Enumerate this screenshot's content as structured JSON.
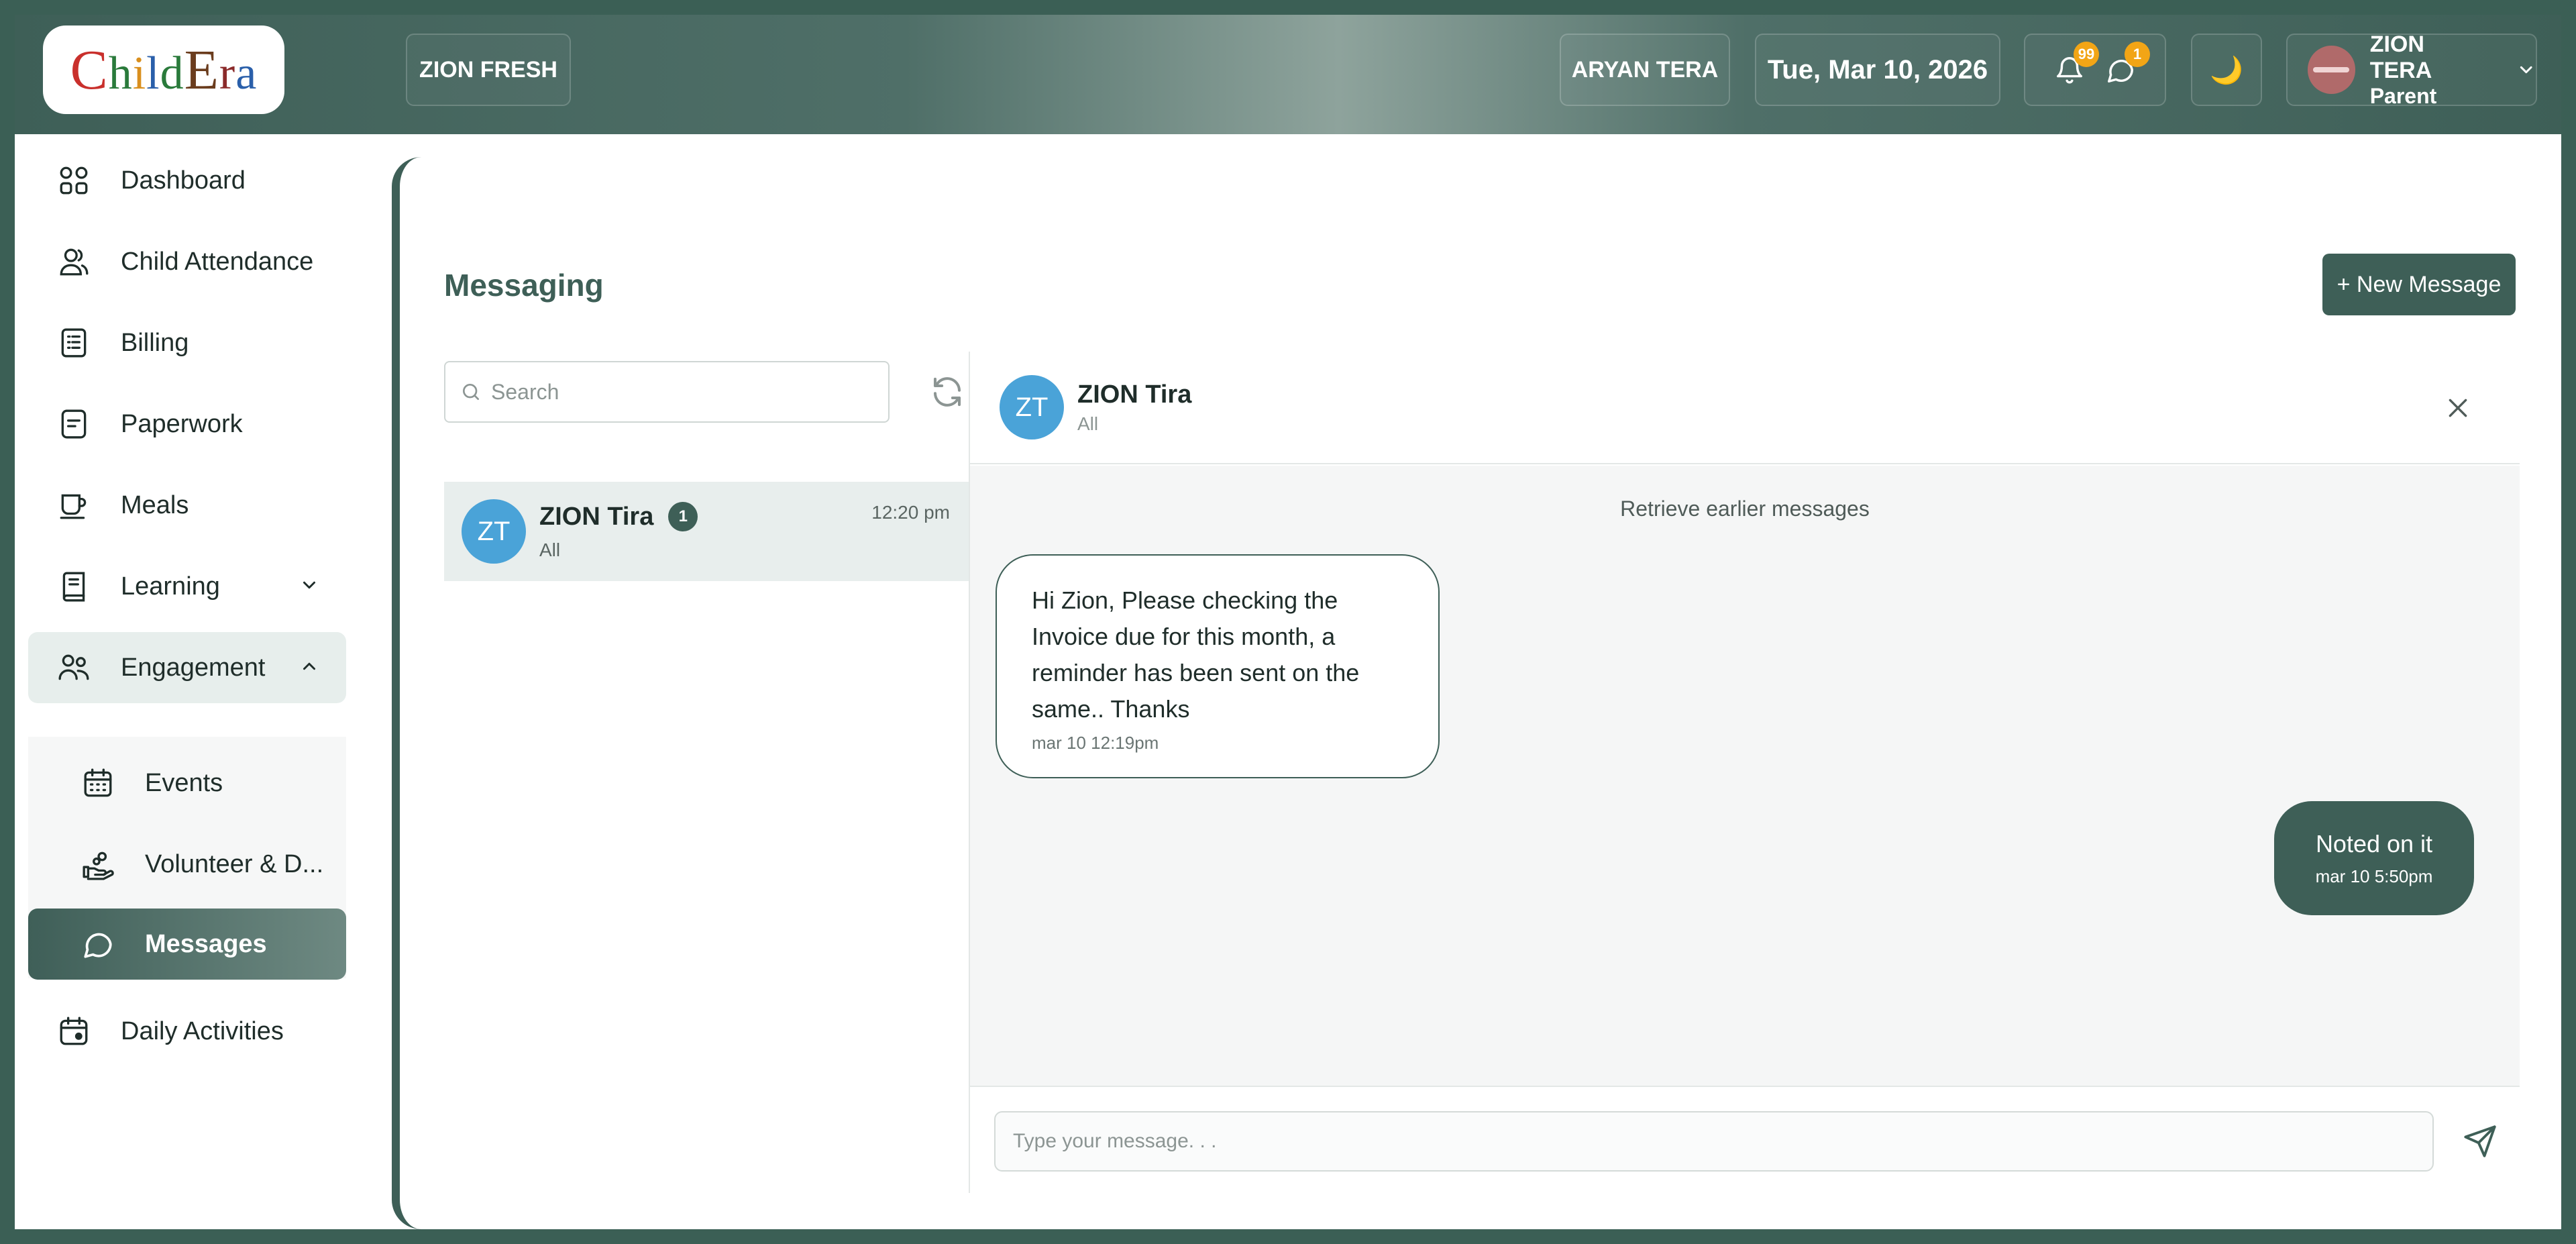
{
  "header": {
    "logo": {
      "text": "ChildEra"
    },
    "school_name": "ZION FRESH",
    "user_name": "ARYAN TERA",
    "date": "Tue, Mar 10, 2026",
    "notifications": {
      "bell_count": "99",
      "chat_count": "1"
    },
    "theme_icon": "🌙",
    "profile": {
      "name": "ZION TERA",
      "role": "Parent"
    }
  },
  "sidebar": {
    "items": [
      {
        "label": "Dashboard",
        "icon": "grid-icon"
      },
      {
        "label": "Child Attendance",
        "icon": "users-icon"
      },
      {
        "label": "Billing",
        "icon": "receipt-icon"
      },
      {
        "label": "Paperwork",
        "icon": "document-icon"
      },
      {
        "label": "Meals",
        "icon": "cup-icon"
      },
      {
        "label": "Learning",
        "icon": "book-icon"
      },
      {
        "label": "Engagement",
        "icon": "people-icon"
      },
      {
        "label": "Events",
        "icon": "calendar-icon"
      },
      {
        "label": "Volunteer & D...",
        "icon": "hand-icon"
      },
      {
        "label": "Messages",
        "icon": "chat-bubble-icon"
      },
      {
        "label": "Daily Activities",
        "icon": "calendar-clock-icon"
      }
    ]
  },
  "main": {
    "title": "Messaging",
    "new_message_label": "+ New Message",
    "search": {
      "placeholder": "Search",
      "value": ""
    },
    "conversations": [
      {
        "initials": "ZT",
        "name": "ZION Tira",
        "unread": "1",
        "group": "All",
        "time": "12:20 pm"
      }
    ],
    "chat": {
      "initials": "ZT",
      "name": "ZION Tira",
      "group": "All",
      "retrieve_label": "Retrieve earlier messages",
      "messages": [
        {
          "direction": "in",
          "text": "Hi Zion, Please checking the Invoice due for this month, a reminder has been sent on the same.. Thanks",
          "time": "mar 10 12:19pm"
        },
        {
          "direction": "out",
          "text": "Noted on it",
          "time": "mar 10 5:50pm"
        }
      ],
      "composer": {
        "placeholder": "Type your message. . .",
        "value": ""
      }
    }
  },
  "colors": {
    "primary": "#3e5f57",
    "avatar_blue": "#4aa3d8",
    "badge_orange": "#f2a516",
    "chat_bg": "#f5f6f6"
  }
}
